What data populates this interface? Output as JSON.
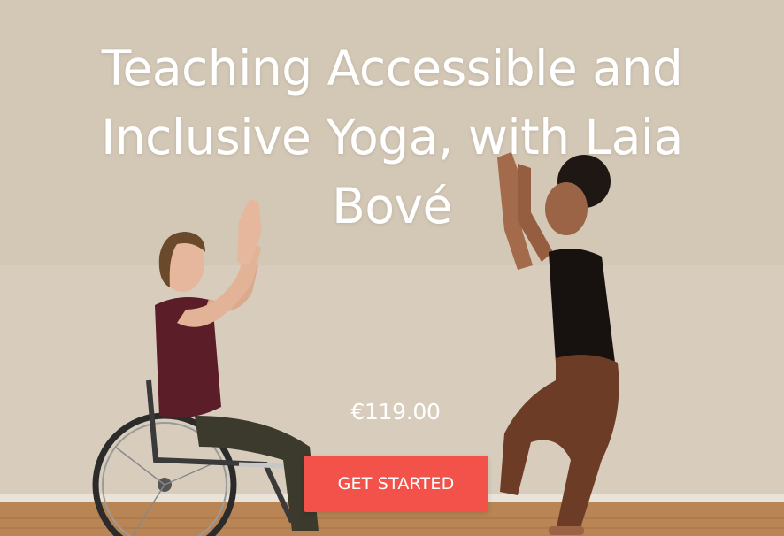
{
  "hero": {
    "title": "Teaching Accessible and Inclusive Yoga, with Laia Bové",
    "price": "€119.00",
    "cta_label": "GET STARTED",
    "accent_color": "#f2524a"
  },
  "photo": {
    "description_icon": "yoga-class-photo"
  }
}
